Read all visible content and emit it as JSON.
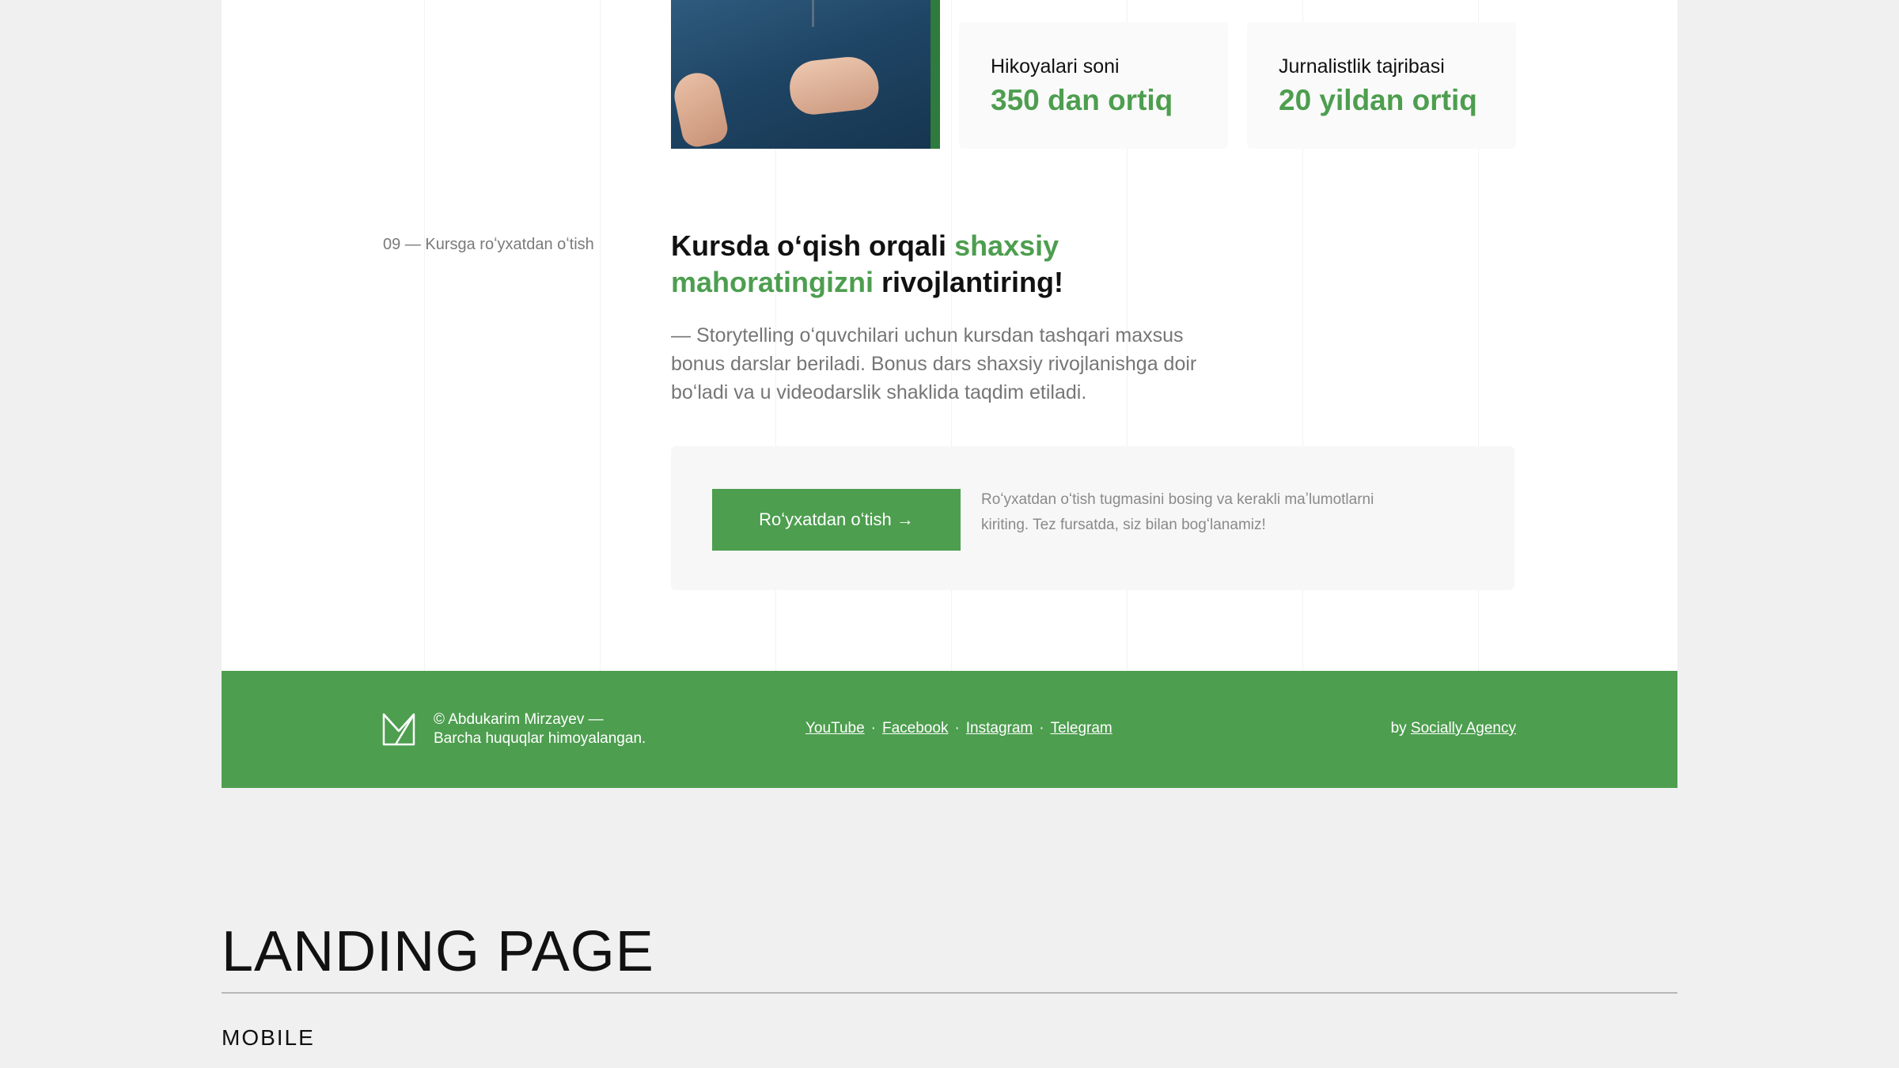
{
  "stats": [
    {
      "label": "Hikoyalari soni",
      "value": "350 dan ortiq"
    },
    {
      "label": "Jurnalistlik tajribasi",
      "value": "20 yildan ortiq"
    }
  ],
  "section": {
    "label": "09 — Kursga roʻyxatdan oʻtish",
    "heading_part1": "Kursda oʻqish orqali ",
    "heading_green1": "shaxsiy mahoratingizni",
    "heading_part2": " rivojlantiring!",
    "description": "— Storytelling oʻquvchilari uchun kursdan tashqari maxsus bonus darslar beriladi. Bonus dars shaxsiy rivojlanishga doir boʻladi va u videodarslik shaklida taqdim etiladi."
  },
  "cta": {
    "button_label": "Roʻyxatdan oʻtish →",
    "note": "Roʻyxatdan oʻtish tugmasini bosing va kerakli maʼlumotlarni kiriting. Tez fursatda, siz bilan bogʻlanamiz!"
  },
  "footer": {
    "copyright_line1": "© Abdukarim Mirzayev —",
    "copyright_line2": "Barcha huquqlar himoyalangan.",
    "links": [
      "YouTube",
      "Facebook",
      "Instagram",
      "Telegram"
    ],
    "separator": "·",
    "credit_prefix": "by ",
    "credit_link": "Socially Agency",
    "logo_icon": "m-monogram-icon"
  },
  "showcase": {
    "title": "LANDING PAGE",
    "subtitle": "MOBILE"
  },
  "colors": {
    "brand_green": "#4d9e4f",
    "background": "#f0f0f0",
    "page": "#ffffff"
  }
}
